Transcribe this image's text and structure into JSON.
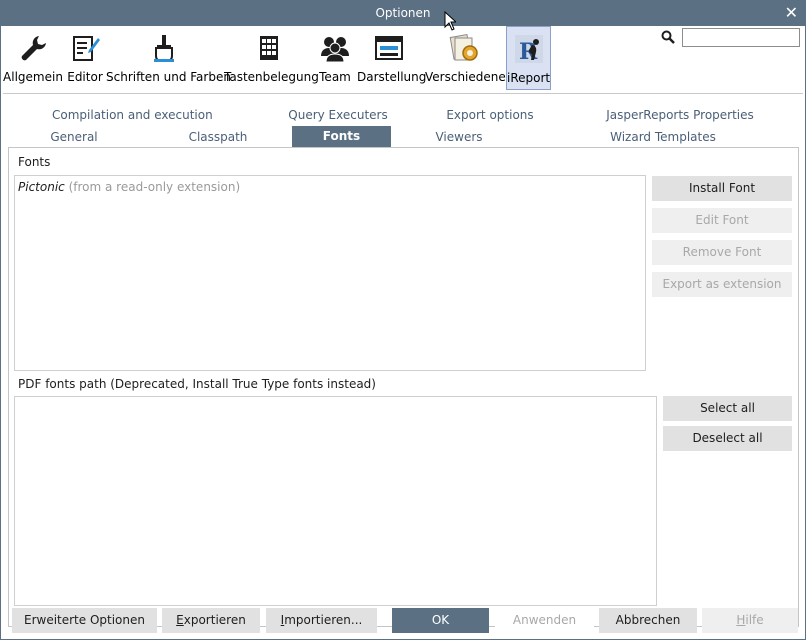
{
  "window": {
    "title": "Optionen",
    "close_label": "✕"
  },
  "toolbar": {
    "items": [
      {
        "label": "Allgemein",
        "icon": "wrench-icon"
      },
      {
        "label": "Editor",
        "icon": "edit-document-icon"
      },
      {
        "label": "Schriften und Farben",
        "icon": "paint-brush-icon"
      },
      {
        "label": "Tastenbelegung",
        "icon": "keyboard-icon"
      },
      {
        "label": "Team",
        "icon": "team-icon"
      },
      {
        "label": "Darstellung",
        "icon": "window-icon"
      },
      {
        "label": "Verschiedenes",
        "icon": "misc-gear-icon"
      },
      {
        "label": "iReport",
        "icon": "ireport-icon"
      }
    ],
    "selected": "iReport"
  },
  "search": {
    "value": "",
    "placeholder": ""
  },
  "tabs": {
    "row1": [
      "Compilation and execution",
      "Query Executers",
      "Export options",
      "JasperReports Properties"
    ],
    "row2": [
      "General",
      "Classpath",
      "Fonts",
      "Viewers",
      "Wizard Templates"
    ],
    "selected": "Fonts"
  },
  "fonts_section": {
    "label": "Fonts",
    "items": [
      {
        "name": "Pictonic",
        "note": "(from a read-only extension)"
      }
    ],
    "buttons": {
      "install": "Install Font",
      "edit": "Edit Font",
      "remove": "Remove Font",
      "export": "Export as extension"
    }
  },
  "pdf_section": {
    "label": "PDF fonts path (Deprecated, Install True Type fonts instead)",
    "buttons": {
      "select_all": "Select all",
      "deselect_all": "Deselect all"
    }
  },
  "bottom_buttons": {
    "advanced": "Erweiterte Optionen",
    "export_first": "E",
    "export_rest": "xportieren",
    "import_first": "I",
    "import_rest": "mportieren...",
    "ok": "OK",
    "apply": "Anwenden",
    "cancel": "Abbrechen",
    "help_first": "H",
    "help_rest": "ilfe"
  }
}
